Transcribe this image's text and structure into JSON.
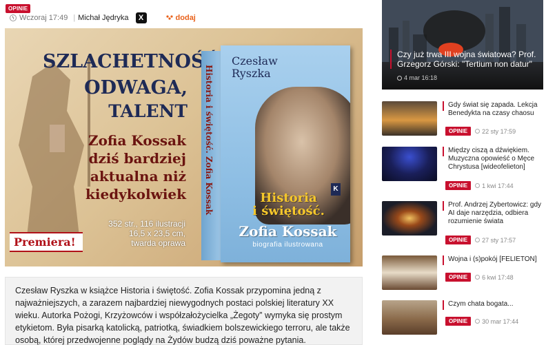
{
  "article": {
    "category": "OPINIE",
    "time": "Wczoraj 17:49",
    "author": "Michał Jędryka",
    "x_label": "X",
    "add_label": "dodaj",
    "lead": "Czesław Ryszka w książce Historia i świętość. Zofia Kossak przypomina jedną z najważniejszych, a zarazem najbardziej niewygodnych postaci polskiej literatury XX wieku. Autorka Pożogi, Krzyżowców i współzałożycielka „Żegoty” wymyka się prostym etykietom. Była pisarką katolicką, patriotką, świadkiem bolszewickiego terroru, ale także osobą, której przedwojenne poglądy na Żydów budzą dziś poważne pytania."
  },
  "hero": {
    "line1": "SZLACHETNOŚĆ,",
    "line2": "ODWAGA,",
    "line3": "TALENT",
    "tag1": "Zofia Kossak",
    "tag2": "dziś bardziej",
    "tag3": "aktualna niż",
    "tag4": "kiedykolwiek",
    "spec1": "352 str., 116 ilustracji",
    "spec2": "16,5 x 23,5 cm,",
    "spec3": "twarda oprawa",
    "premiera": "Premiera!",
    "book_author_1": "Czesław",
    "book_author_2": "Ryszka",
    "book_title_1": "Historia",
    "book_title_2": "i świętość.",
    "book_name": "Zofia Kossak",
    "book_subtitle": "biografia ilustrowana",
    "spine_text": "Historia i świętość. Zofia Kossak"
  },
  "sidebar": {
    "feature": {
      "title": "Czy już trwa III wojna światowa? Prof. Grzegorz Górski: \"Tertium non datur\"",
      "date": "4 mar 16:18"
    },
    "items": [
      {
        "title": "Gdy świat się zapada. Lekcja Benedykta na czasy chaosu",
        "category": "OPINIE",
        "date": "22 sty 17:59"
      },
      {
        "title": "Między ciszą a dźwiękiem. Muzyczna opowieść o Męce Chrystusa [wideofelieton]",
        "category": "OPINIE",
        "date": "1 kwi 17:44"
      },
      {
        "title": "Prof. Andrzej Zybertowicz: gdy AI daje narzędzia, odbiera rozumienie świata",
        "category": "OPINIE",
        "date": "27 sty 17:57"
      },
      {
        "title": "Wojna i (s)pokój [FELIETON]",
        "category": "OPINIE",
        "date": "6 kwi 17:48"
      },
      {
        "title": "Czym chata bogata...",
        "category": "OPINIE",
        "date": "30 mar 17:44"
      }
    ]
  },
  "colors": {
    "accent": "#c8102e",
    "link_orange": "#e9621b",
    "headline_navy": "#1e2a56"
  }
}
